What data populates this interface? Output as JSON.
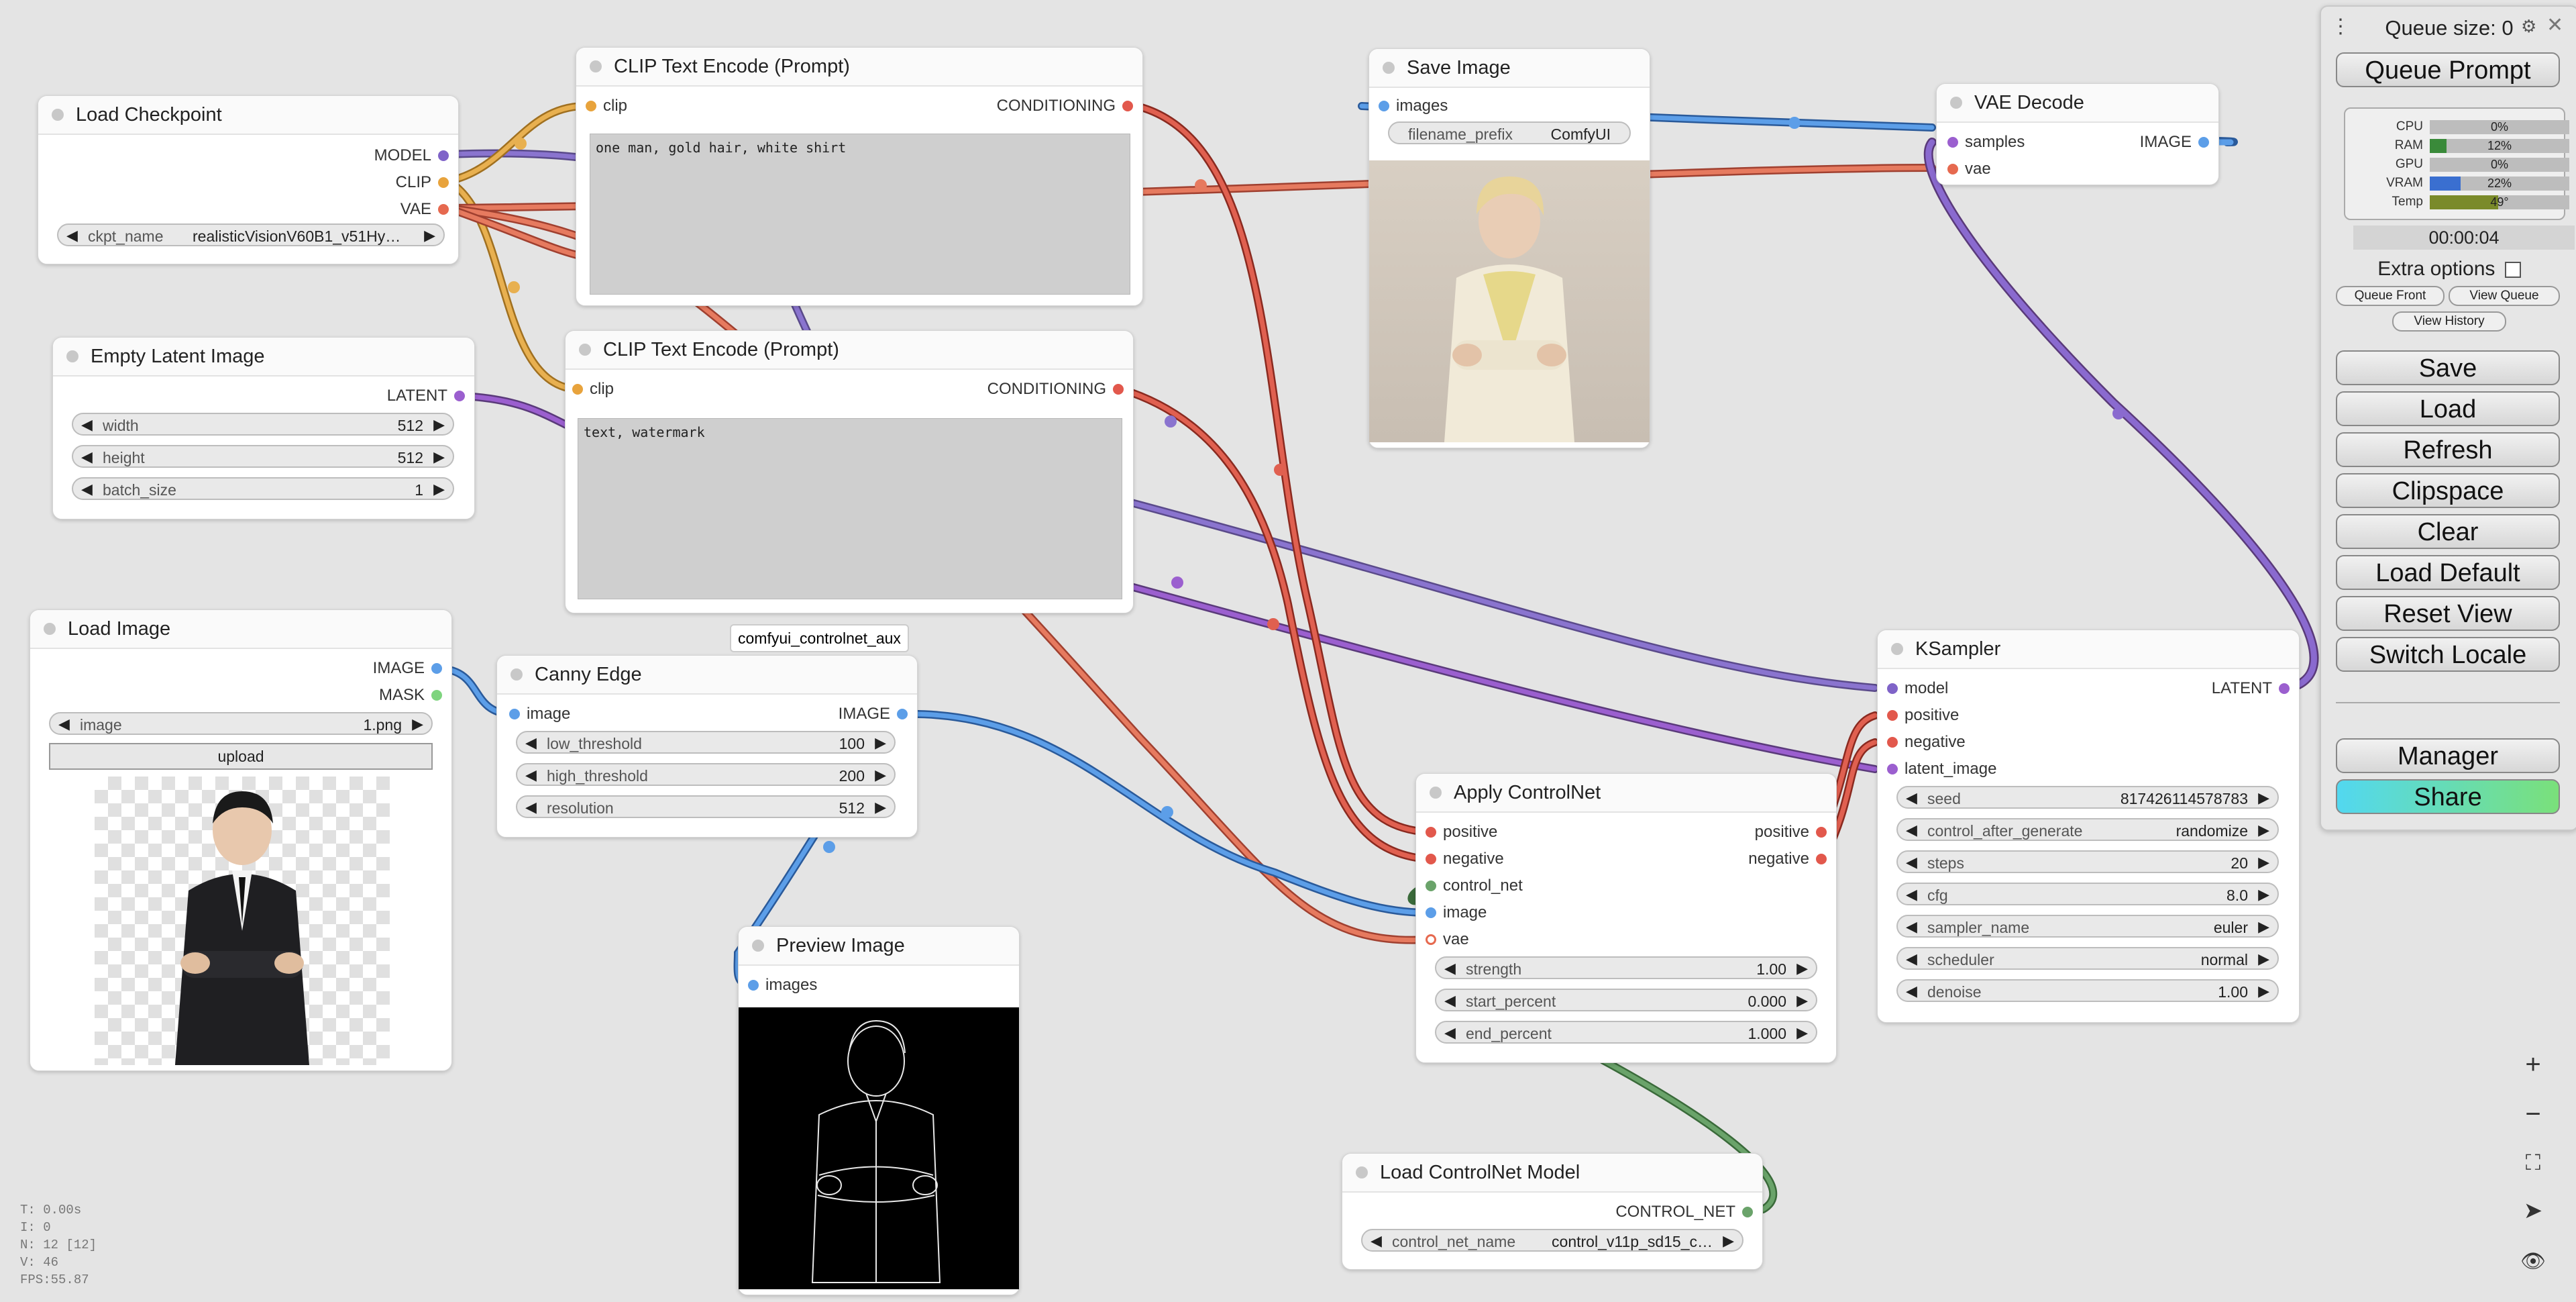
{
  "colors": {
    "canvas_bg": "#e4e4e4",
    "model": "#7f63c8",
    "clip": "#e8a33c",
    "vae": "#e6694f",
    "latent": "#9b5fcf",
    "conditioning": "#e2584c",
    "image": "#5c9ee8",
    "mask": "#7ed47e",
    "control_net": "#6aa36a",
    "accent_share": "#52d8f0"
  },
  "nodes": {
    "load_checkpoint": {
      "title": "Load Checkpoint",
      "outputs": [
        "MODEL",
        "CLIP",
        "VAE"
      ],
      "widget_label": "ckpt_name",
      "widget_value": "realisticVisionV60B1_v51Hy…"
    },
    "clip_pos": {
      "title": "CLIP Text Encode (Prompt)",
      "input": "clip",
      "output": "CONDITIONING",
      "text": "one man, gold hair, white shirt"
    },
    "clip_neg": {
      "title": "CLIP Text Encode (Prompt)",
      "input": "clip",
      "output": "CONDITIONING",
      "text": "text, watermark"
    },
    "empty_latent": {
      "title": "Empty Latent Image",
      "output": "LATENT",
      "widgets": [
        {
          "label": "width",
          "value": "512"
        },
        {
          "label": "height",
          "value": "512"
        },
        {
          "label": "batch_size",
          "value": "1"
        }
      ]
    },
    "load_image": {
      "title": "Load Image",
      "outputs": [
        "IMAGE",
        "MASK"
      ],
      "widget_label": "image",
      "widget_value": "1.png",
      "upload_label": "upload"
    },
    "canny": {
      "title": "Canny Edge",
      "badge": "comfyui_controlnet_aux",
      "input": "image",
      "output": "IMAGE",
      "widgets": [
        {
          "label": "low_threshold",
          "value": "100"
        },
        {
          "label": "high_threshold",
          "value": "200"
        },
        {
          "label": "resolution",
          "value": "512"
        }
      ]
    },
    "preview": {
      "title": "Preview Image",
      "input": "images"
    },
    "save_image": {
      "title": "Save Image",
      "input": "images",
      "widget_label": "filename_prefix",
      "widget_value": "ComfyUI"
    },
    "vae_decode": {
      "title": "VAE Decode",
      "inputs": [
        "samples",
        "vae"
      ],
      "output": "IMAGE"
    },
    "apply_cn": {
      "title": "Apply ControlNet",
      "inputs": [
        "positive",
        "negative",
        "control_net",
        "image",
        "vae"
      ],
      "outputs": [
        "positive",
        "negative"
      ],
      "widgets": [
        {
          "label": "strength",
          "value": "1.00"
        },
        {
          "label": "start_percent",
          "value": "0.000"
        },
        {
          "label": "end_percent",
          "value": "1.000"
        }
      ]
    },
    "load_cn": {
      "title": "Load ControlNet Model",
      "output": "CONTROL_NET",
      "widget_label": "control_net_name",
      "widget_value": "control_v11p_sd15_c…"
    },
    "ksampler": {
      "title": "KSampler",
      "inputs": [
        "model",
        "positive",
        "negative",
        "latent_image"
      ],
      "output": "LATENT",
      "widgets": [
        {
          "label": "seed",
          "value": "817426114578783"
        },
        {
          "label": "control_after_generate",
          "value": "randomize"
        },
        {
          "label": "steps",
          "value": "20"
        },
        {
          "label": "cfg",
          "value": "8.0"
        },
        {
          "label": "sampler_name",
          "value": "euler"
        },
        {
          "label": "scheduler",
          "value": "normal"
        },
        {
          "label": "denoise",
          "value": "1.00"
        }
      ]
    }
  },
  "panel": {
    "queue_size": "Queue size: 0",
    "queue_prompt": "Queue Prompt",
    "stats": [
      {
        "label": "CPU",
        "value": "0%",
        "pct": 0,
        "color": "#3a9a3a"
      },
      {
        "label": "RAM",
        "value": "12%",
        "pct": 12,
        "color": "#3a8a3a"
      },
      {
        "label": "GPU",
        "value": "0%",
        "pct": 0,
        "color": "#3a9a3a"
      },
      {
        "label": "VRAM",
        "value": "22%",
        "pct": 22,
        "color": "#3a6fd0"
      },
      {
        "label": "Temp",
        "value": "49°",
        "pct": 49,
        "color": "#7a8a2a"
      }
    ],
    "timer": "00:00:04",
    "extra_options": "Extra options",
    "queue_front": "Queue Front",
    "view_queue": "View Queue",
    "view_history": "View History",
    "buttons": [
      "Save",
      "Load",
      "Refresh",
      "Clipspace",
      "Clear",
      "Load Default",
      "Reset View",
      "Switch Locale"
    ],
    "manager": "Manager",
    "share": "Share"
  },
  "overlay_stats": [
    "T: 0.00s",
    "I: 0",
    "N: 12 [12]",
    "V: 46",
    "FPS:55.87"
  ]
}
